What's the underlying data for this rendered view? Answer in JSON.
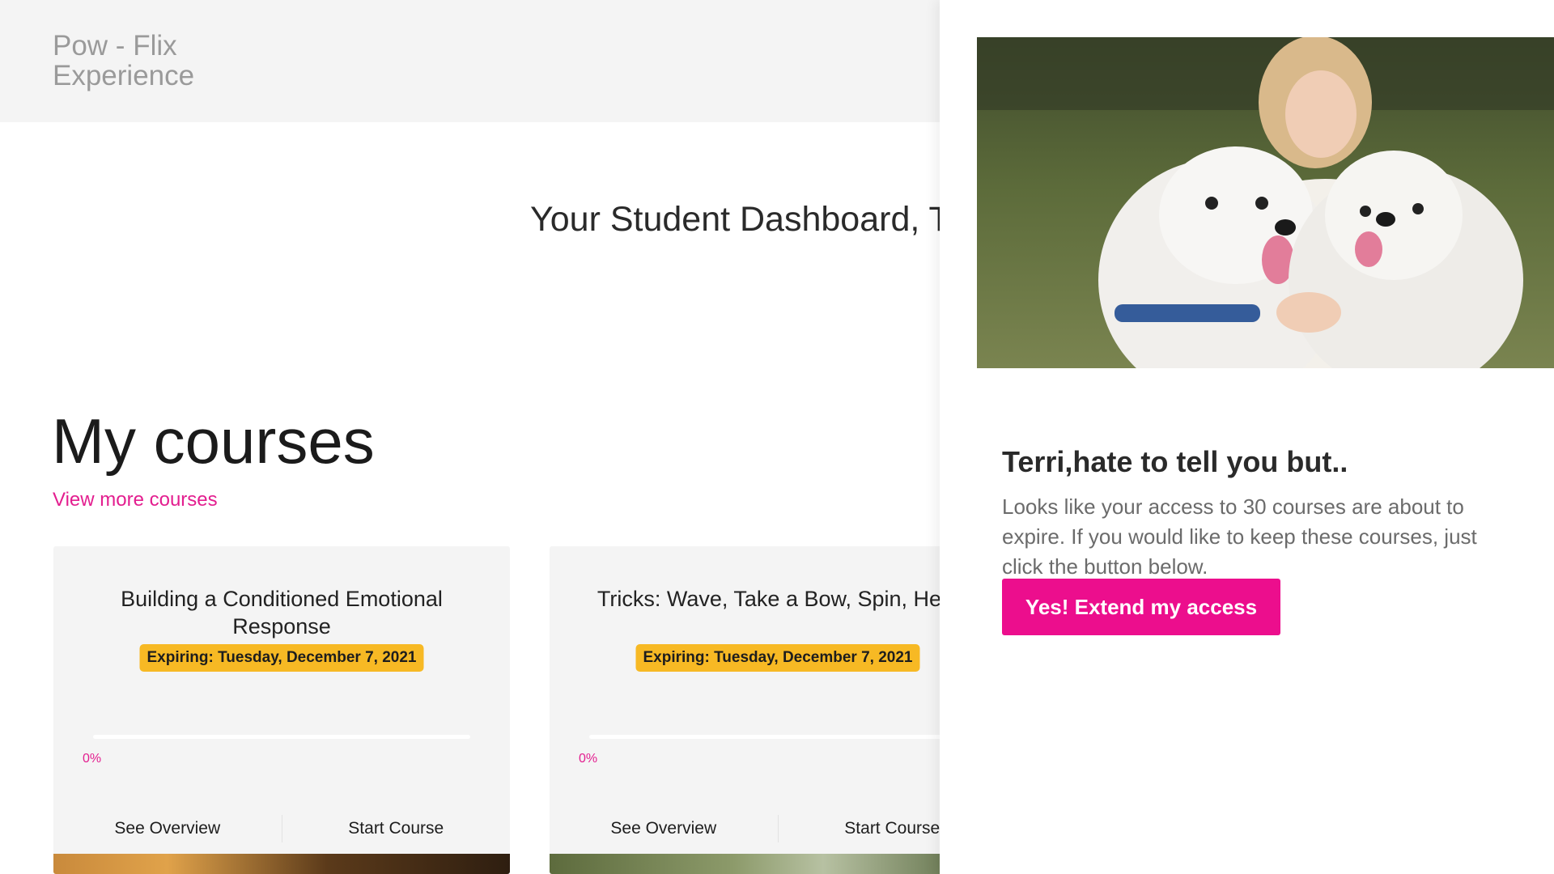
{
  "brand": {
    "line1": "Pow - Flix",
    "line2": "Experience"
  },
  "dashboard_title": "Your Student Dashboard, T",
  "courses": {
    "heading": "My courses",
    "view_more": "View more courses",
    "items": [
      {
        "title": "Building a Conditioned Emotional Response",
        "expiry": "Expiring: Tuesday, December 7, 2021",
        "progress": 0,
        "progress_label": "0%",
        "overview_label": "See Overview",
        "start_label": "Start Course"
      },
      {
        "title": "Tricks: Wave, Take a Bow, Spin, Heel",
        "expiry": "Expiring: Tuesday, December 7, 2021",
        "progress": 0,
        "progress_label": "0%",
        "overview_label": "See Overview",
        "start_label": "Start Course"
      }
    ]
  },
  "modal": {
    "heading": "Terri,hate to tell you but..",
    "body": "Looks like your access to 30 courses are about to expire. If you would like to keep these courses, just click the button below.",
    "button_label": "Yes! Extend my access"
  },
  "colors": {
    "accent": "#ec0e8d",
    "link": "#e31e8f",
    "badge": "#f7b924",
    "topbar": "#f4f4f4",
    "card": "#f4f4f4"
  }
}
